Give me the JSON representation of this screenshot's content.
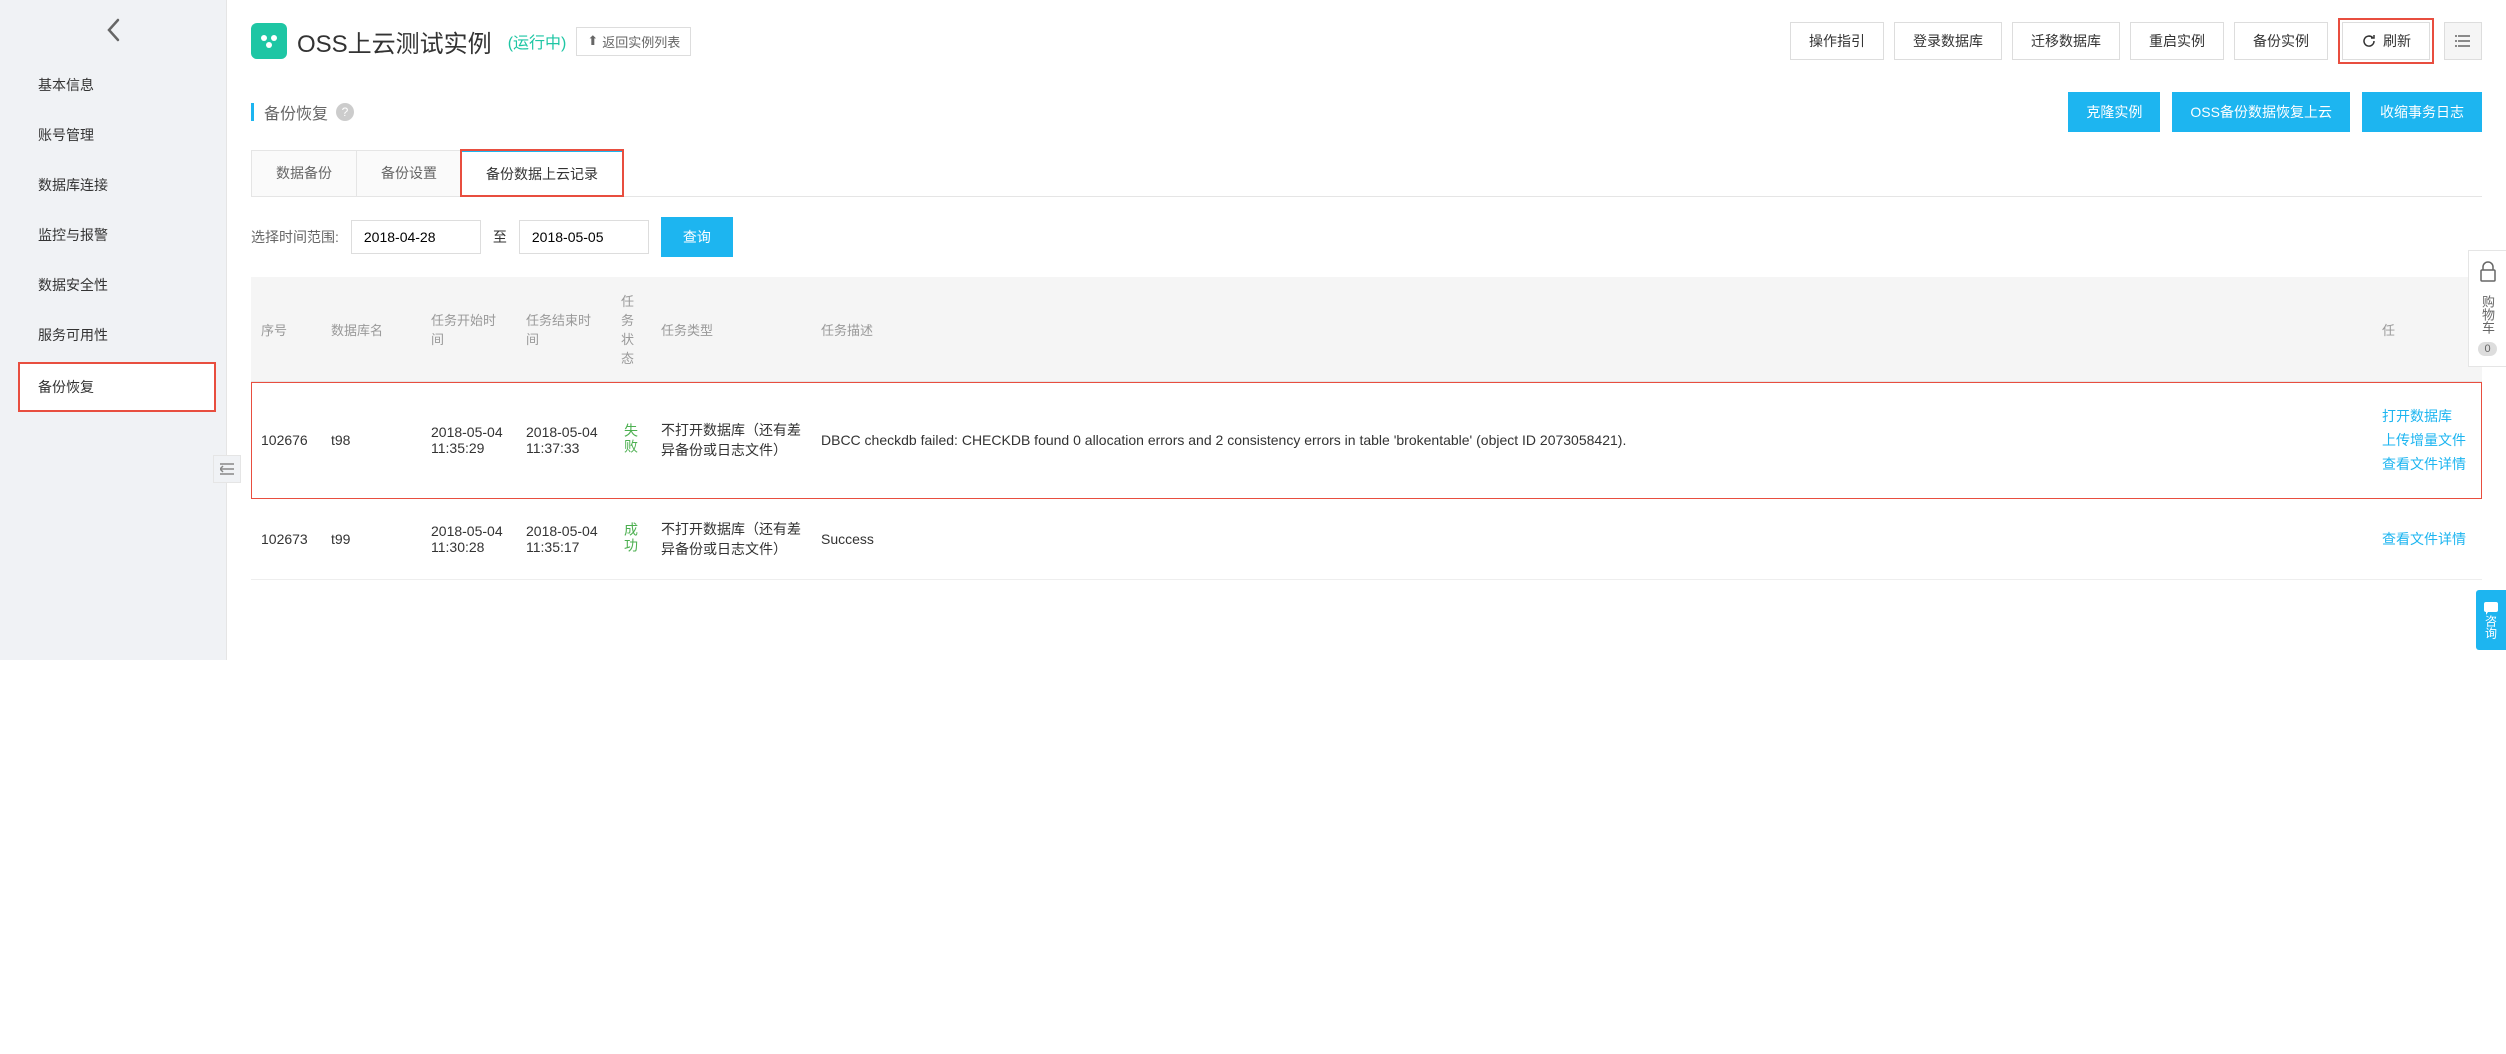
{
  "header": {
    "title": "OSS上云测试实例",
    "status": "(运行中)",
    "back_list": "返回实例列表",
    "buttons": {
      "guide": "操作指引",
      "login_db": "登录数据库",
      "migrate_db": "迁移数据库",
      "restart": "重启实例",
      "backup": "备份实例",
      "refresh": "刷新"
    }
  },
  "sidebar": {
    "items": [
      "基本信息",
      "账号管理",
      "数据库连接",
      "监控与报警",
      "数据安全性",
      "服务可用性",
      "备份恢复"
    ]
  },
  "section": {
    "title": "备份恢复",
    "actions": {
      "clone": "克隆实例",
      "oss_restore": "OSS备份数据恢复上云",
      "shrink_log": "收缩事务日志"
    }
  },
  "tabs": {
    "items": [
      "数据备份",
      "备份设置",
      "备份数据上云记录"
    ],
    "active_index": 2
  },
  "filter": {
    "label": "选择时间范围:",
    "date_from": "2018-04-28",
    "to": "至",
    "date_to": "2018-05-05",
    "query": "查询"
  },
  "table": {
    "headers": {
      "seq": "序号",
      "db_name": "数据库名",
      "start_time": "任务开始时间",
      "end_time": "任务结束时间",
      "status": "任务状态",
      "type": "任务类型",
      "desc": "任务描述",
      "ops": "任"
    },
    "rows": [
      {
        "seq": "102676",
        "db_name": "t98",
        "start_time": "2018-05-04 11:35:29",
        "end_time": "2018-05-04 11:37:33",
        "status": "失败",
        "type": "不打开数据库（还有差异备份或日志文件）",
        "desc": "DBCC checkdb failed: CHECKDB found 0 allocation errors and 2 consistency errors in table 'brokentable' (object ID 2073058421).",
        "ops": [
          "打开数据库",
          "上传增量文件",
          "查看文件详情"
        ]
      },
      {
        "seq": "102673",
        "db_name": "t99",
        "start_time": "2018-05-04 11:30:28",
        "end_time": "2018-05-04 11:35:17",
        "status": "成功",
        "type": "不打开数据库（还有差异备份或日志文件）",
        "desc": "Success",
        "ops": [
          "查看文件详情"
        ]
      }
    ]
  },
  "cart": {
    "label": "购物车",
    "count": "0"
  },
  "chat": {
    "label": "咨询"
  }
}
